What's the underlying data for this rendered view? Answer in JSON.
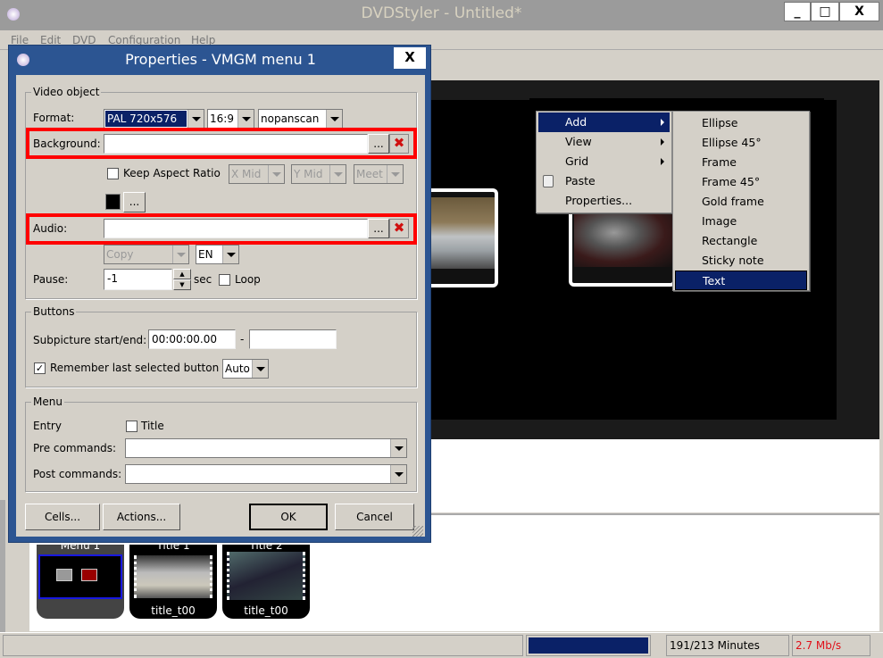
{
  "app": {
    "title": "DVDStyler - Untitled*",
    "minimize": "_",
    "maximize": "□",
    "close": "X"
  },
  "menubar": [
    "File",
    "Edit",
    "DVD",
    "Configuration",
    "Help"
  ],
  "context_menu": {
    "items": [
      {
        "label": "Add",
        "submenu": true,
        "selected": true
      },
      {
        "label": "View",
        "submenu": true
      },
      {
        "label": "Grid",
        "submenu": true
      },
      {
        "label": "Paste",
        "icon": "clipboard-icon"
      },
      {
        "label": "Properties..."
      }
    ],
    "add_submenu": [
      "Ellipse",
      "Ellipse 45°",
      "Frame",
      "Frame 45°",
      "Gold frame",
      "Image",
      "Rectangle",
      "Sticky note",
      "Text"
    ],
    "add_submenu_selected": "Text"
  },
  "thumbnails": [
    {
      "top": "Menu 1",
      "label": ""
    },
    {
      "top": "Title 1",
      "label": "title_t00"
    },
    {
      "top": "Title 2",
      "label": "title_t00"
    }
  ],
  "status": {
    "progress_fraction": 1.0,
    "minutes": "191/213 Minutes",
    "bitrate": "2.7 Mb/s",
    "bitrate_color": "#e0101a"
  },
  "dialog": {
    "title": "Properties - VMGM menu 1",
    "close": "X",
    "video_object": {
      "group": "Video object",
      "format_label": "Format:",
      "format": "PAL 720x576",
      "aspect": "16:9",
      "panscan": "nopanscan",
      "background_label": "Background:",
      "background_value": "",
      "browse": "...",
      "keep_aspect_label": "Keep Aspect Ratio",
      "keep_aspect_checked": false,
      "x_align": "X Mid",
      "y_align": "Y Mid",
      "meet": "Meet",
      "color": "#000000",
      "color_browse": "...",
      "audio_label": "Audio:",
      "audio_value": "",
      "audio_browse": "...",
      "audio_mode": "Copy",
      "audio_lang": "EN",
      "pause_label": "Pause:",
      "pause_value": "-1",
      "sec": "sec",
      "loop_label": "Loop",
      "loop_checked": false
    },
    "buttons": {
      "group": "Buttons",
      "subpicture_label": "Subpicture start/end:",
      "start": "00:00:00.00",
      "dash": "-",
      "end": "",
      "remember_label": "Remember last selected button",
      "remember_checked": true,
      "remember_mode": "Auto"
    },
    "menu": {
      "group": "Menu",
      "entry_label": "Entry",
      "title_label": "Title",
      "title_checked": false,
      "pre_label": "Pre commands:",
      "pre_value": "",
      "post_label": "Post commands:",
      "post_value": ""
    },
    "actions": {
      "cells": "Cells...",
      "actions": "Actions...",
      "ok": "OK",
      "cancel": "Cancel"
    }
  }
}
